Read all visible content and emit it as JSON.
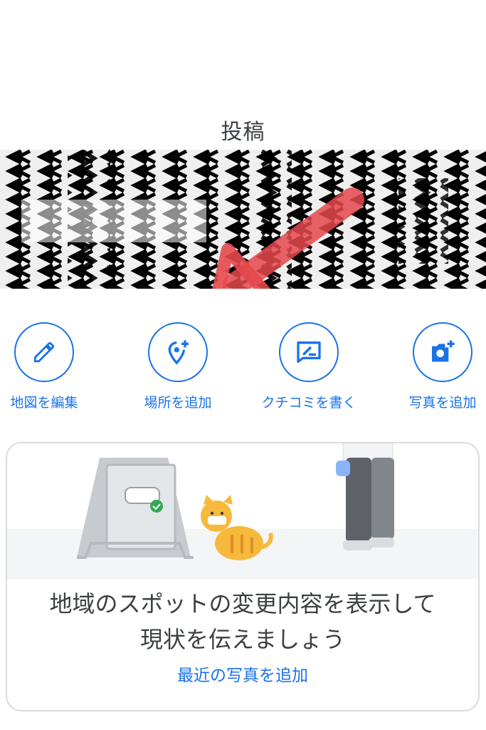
{
  "header": {
    "title": "投稿"
  },
  "actions": [
    {
      "label": "地図を編集",
      "icon": "pencil-icon"
    },
    {
      "label": "場所を追加",
      "icon": "add-location-icon"
    },
    {
      "label": "クチコミを書く",
      "icon": "write-review-icon"
    },
    {
      "label": "写真を追加",
      "icon": "add-photo-icon"
    }
  ],
  "card": {
    "message_line1": "地域のスポットの変更内容を表示して",
    "message_line2": "現状を伝えましょう",
    "link": "最近の写真を追加"
  },
  "colors": {
    "accent": "#1a73e8",
    "arrow": "#e5484d",
    "text": "#3c4043",
    "card_border": "#dadce0"
  }
}
